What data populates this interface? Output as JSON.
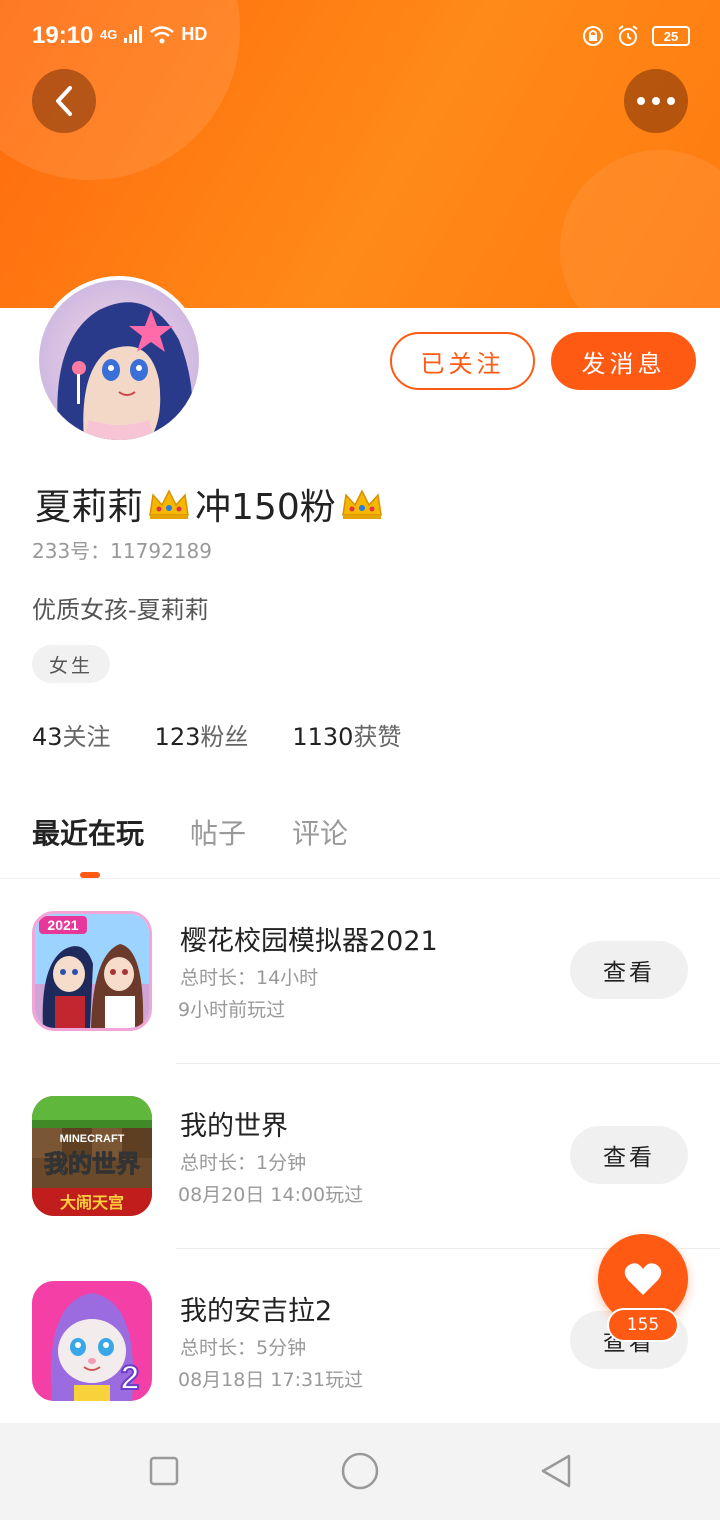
{
  "status_bar": {
    "time": "19:10",
    "network": "4G",
    "hd": "HD",
    "battery": "25"
  },
  "profile": {
    "name": "夏莉莉",
    "name_suffix": "冲150粉",
    "crown_icon": "crown-emoji",
    "uid_text": "233号：11792189",
    "bio": "优质女孩-夏莉莉",
    "gender_tag": "女生"
  },
  "actions": {
    "following_label": "已关注",
    "message_label": "发消息"
  },
  "stats": [
    {
      "num": "43",
      "label": "关注"
    },
    {
      "num": "123",
      "label": "粉丝"
    },
    {
      "num": "1130",
      "label": "获赞"
    }
  ],
  "tabs": [
    {
      "label": "最近在玩",
      "active": true
    },
    {
      "label": "帖子",
      "active": false
    },
    {
      "label": "评论",
      "active": false
    }
  ],
  "games": [
    {
      "title": "樱花校园模拟器2021",
      "duration": "总时长：14小时",
      "last_played": "9小时前玩过",
      "view_label": "查看"
    },
    {
      "title": "我的世界",
      "duration": "总时长：1分钟",
      "last_played": "08月20日 14:00玩过",
      "view_label": "查看",
      "icon_text_top": "MINECRAFT",
      "icon_text_mid": "我的世界",
      "icon_text_bottom": "大闹天宫"
    },
    {
      "title": "我的安吉拉2",
      "duration": "总时长：5分钟",
      "last_played": "08月18日 17:31玩过",
      "view_label": "查看",
      "icon_badge": "2"
    }
  ],
  "like_fab": {
    "count": "155"
  },
  "colors": {
    "accent": "#ff5a14",
    "banner": "#ff7a10"
  }
}
